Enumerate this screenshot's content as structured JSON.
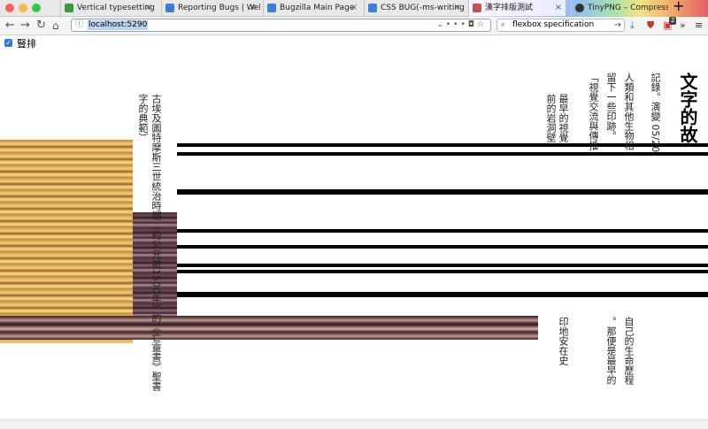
{
  "browser": {
    "tabs": [
      {
        "label": "Vertical typesetting wi",
        "icon": "spreadsheet-icon",
        "color": "#3a9b3a"
      },
      {
        "label": "Reporting Bugs | Webk",
        "icon": "webkit-icon",
        "color": "#3b7fd9"
      },
      {
        "label": "Bugzilla Main Page",
        "icon": "webkit-icon",
        "color": "#3b7fd9"
      },
      {
        "label": "CSS BUG(-ms-writing",
        "icon": "webkit-icon",
        "color": "#3b7fd9"
      },
      {
        "label": "漢字排版測試",
        "icon": "page-icon",
        "color": "#b55"
      },
      {
        "label": "TinyPNG – Compress",
        "icon": "panda-icon",
        "color": "#333"
      }
    ],
    "new_tab_label": "+",
    "url": "localhost:5290",
    "search_value": "flexbox specification",
    "badge_count": "2"
  },
  "page": {
    "checkbox_label": "豎排",
    "checkbox_checked": true,
    "title": "文字的故",
    "columns_top": [
      {
        "text": "記錄。演變 05/20"
      },
      {
        "text": "人類和其他生物相"
      },
      {
        "text": "留下一些印跡。"
      },
      {
        "text": "「視覺交流與傳播"
      },
      {
        "text": "最早的視覺"
      },
      {
        "text": "前的岩洞壁"
      }
    ],
    "columns_bottom": [
      {
        "text": "自己的生命歷程"
      },
      {
        "text": "。那便是最早的"
      },
      {
        "text": "印地安在史"
      }
    ],
    "left_columns": [
      {
        "text": "古埃及圖特摩斯三世統治時期（約公元前1500年）的《亡靈書》聖書"
      },
      {
        "text": "字的典範）"
      }
    ]
  }
}
